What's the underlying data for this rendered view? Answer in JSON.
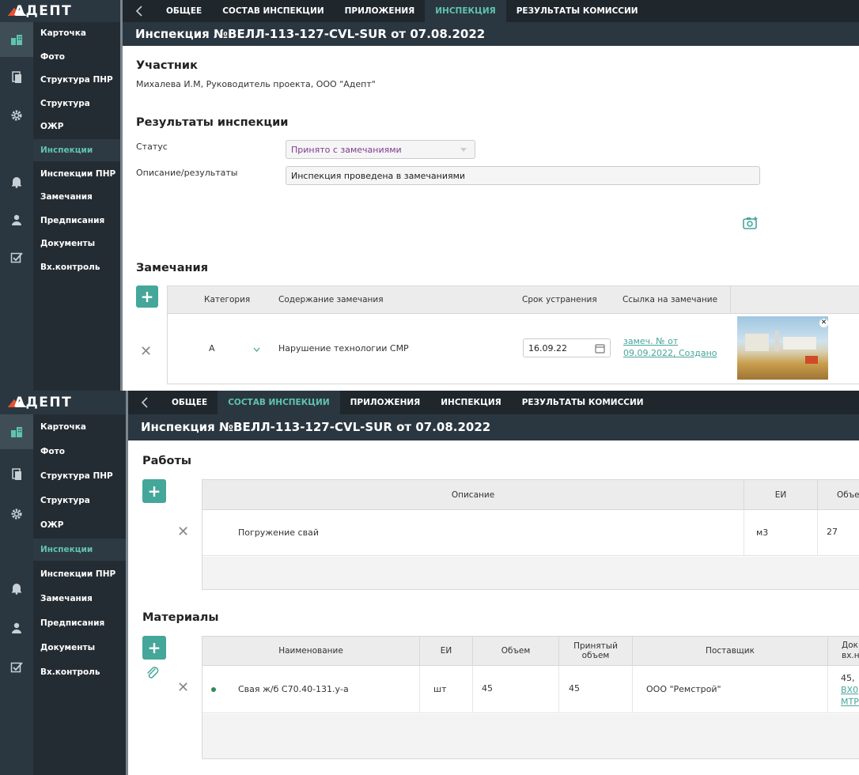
{
  "app": {
    "logo_text": "АДЕПТ",
    "brand_color": "#5fc3b0"
  },
  "menu_items": [
    "Карточка",
    "Фото",
    "Структура ПНР",
    "Структура",
    "ОЖР",
    "Инспекции",
    "Инспекции ПНР",
    "Замечания",
    "Предписания",
    "Документы",
    "Вх.контроль"
  ],
  "active_menu": "Инспекции",
  "rail_icons": [
    "buildings-icon",
    "documents-icon",
    "gear-icon",
    "bell-icon",
    "user-icon",
    "checklist-icon"
  ],
  "tabs": [
    "ОБЩЕЕ",
    "СОСТАВ ИНСПЕКЦИИ",
    "ПРИЛОЖЕНИЯ",
    "ИНСПЕКЦИЯ",
    "РЕЗУЛЬТАТЫ КОМИССИИ"
  ],
  "title": "Инспекция №ВЕЛЛ-113-127-CVL-SUR от 07.08.2022",
  "inspection": {
    "active_tab": "ИНСПЕКЦИЯ",
    "participant_heading": "Участник",
    "participant": "Михалева И.М, Руководитель проекта, ООО \"Адепт\"",
    "results_heading": "Результаты инспекции",
    "status_label": "Статус",
    "status_value": "Принято с замечаниями",
    "description_label": "Описание/результаты",
    "description_value": "Инспекция проведена в замечаниями",
    "remarks_heading": "Замечания",
    "remarks_columns": [
      "Категория",
      "Содержание замечания",
      "Срок устранения",
      "Ссылка на замечание"
    ],
    "remarks_rows": [
      {
        "category": "А",
        "content": "Нарушение технологии СМР",
        "deadline": "16.09.22",
        "link_line1": "замеч. № от",
        "link_line2": "09.09.2022, Создано"
      }
    ]
  },
  "composition": {
    "active_tab": "СОСТАВ ИНСПЕКЦИИ",
    "works_heading": "Работы",
    "works_columns": [
      "Описание",
      "ЕИ",
      "Объе"
    ],
    "works_rows": [
      {
        "description": "Погружение свай",
        "unit": "м3",
        "volume": "27"
      }
    ],
    "materials_heading": "Материалы",
    "materials_columns": [
      "Наименование",
      "ЕИ",
      "Объем",
      "Принятый объем",
      "Поставщик",
      "Док вх.н"
    ],
    "materials_rows": [
      {
        "name": "Свая ж/б С70.40-131.у-а",
        "unit": "шт",
        "volume": "45",
        "accepted": "45",
        "supplier": "ООО \"Ремстрой\"",
        "doc_line1": "45,",
        "doc_line2": "ВХ0",
        "doc_line3": "МТР"
      }
    ]
  }
}
